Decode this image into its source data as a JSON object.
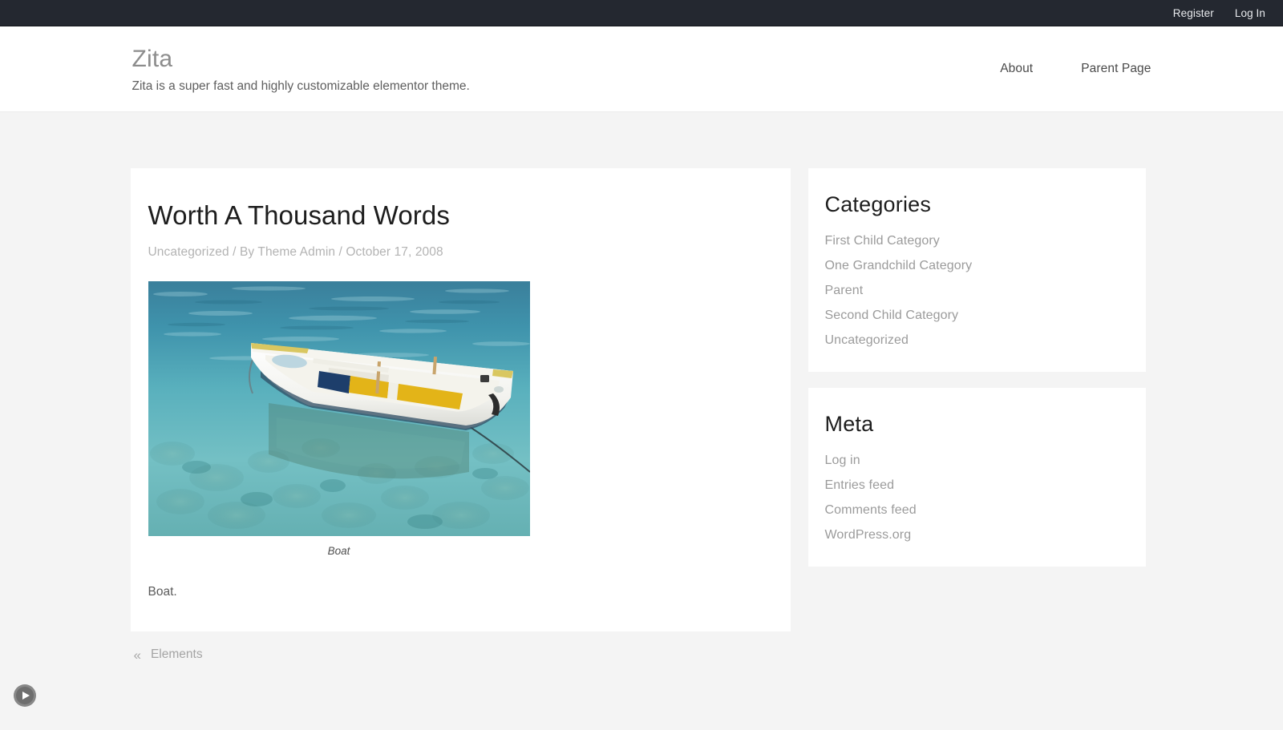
{
  "topbar": {
    "register_label": "Register",
    "login_label": "Log In"
  },
  "header": {
    "site_title": "Zita",
    "tagline": "Zita is a super fast and highly customizable elementor theme.",
    "nav": [
      {
        "label": "About"
      },
      {
        "label": "Parent Page"
      }
    ]
  },
  "article": {
    "title": "Worth A Thousand Words",
    "meta": "Uncategorized / By Theme Admin / October 17, 2008",
    "category": "Uncategorized",
    "author": "Theme Admin",
    "date": "October 17, 2008",
    "figure_caption": "Boat",
    "figure_alt": "boat-photo",
    "body": "Boat."
  },
  "post_nav": {
    "prev_arrow": "«",
    "prev_label": "Elements"
  },
  "sidebar": {
    "categories": {
      "title": "Categories",
      "items": [
        {
          "label": "First Child Category"
        },
        {
          "label": "One Grandchild Category"
        },
        {
          "label": "Parent"
        },
        {
          "label": "Second Child Category"
        },
        {
          "label": "Uncategorized"
        }
      ]
    },
    "meta": {
      "title": "Meta",
      "items": [
        {
          "label": "Log in"
        },
        {
          "label": "Entries feed"
        },
        {
          "label": "Comments feed"
        },
        {
          "label": "WordPress.org"
        }
      ]
    }
  },
  "floating": {
    "play_icon": "play-icon"
  },
  "colors": {
    "topbar_bg": "#242830",
    "page_bg": "#f4f4f4",
    "card_bg": "#ffffff",
    "heading": "#1d1d1d",
    "muted_link": "#9b9b9b",
    "site_title": "#8d8d8d"
  }
}
